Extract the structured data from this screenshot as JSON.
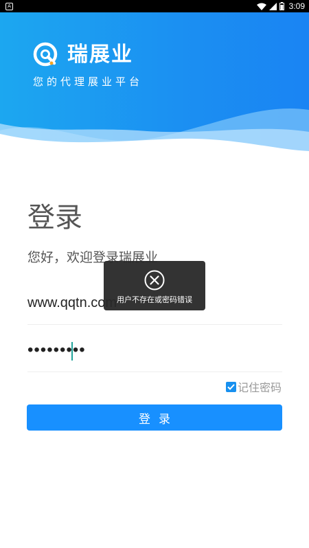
{
  "status_bar": {
    "app_icon": "A",
    "time": "3:09",
    "icons": [
      "wifi-icon",
      "signal-icon",
      "battery-icon"
    ]
  },
  "header": {
    "brand_name": "瑞展业",
    "slogan": "您的代理展业平台",
    "logo_icon": "brand-logo-icon"
  },
  "login": {
    "title": "登录",
    "subtitle": "您好，欢迎登录瑞展业",
    "username_value": "www.qqtn.com",
    "password_value": "•••••••••",
    "remember_label": "记住密码",
    "remember_checked": true,
    "submit_label": "登录"
  },
  "toast": {
    "icon": "close-circle-icon",
    "message": "用户不存在或密码错误"
  },
  "colors": {
    "primary": "#1890ff",
    "header_start": "#1ca7f0",
    "header_end": "#1a84f3",
    "text": "#555555"
  }
}
